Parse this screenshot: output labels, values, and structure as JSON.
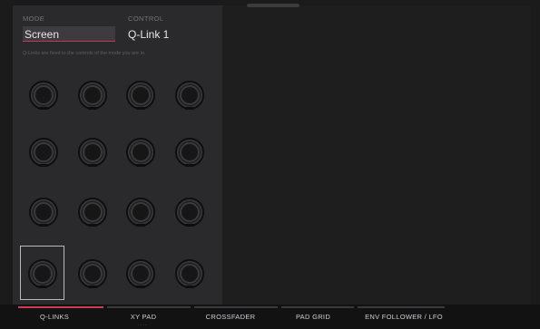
{
  "header": {
    "mode_label": "MODE",
    "mode_value": "Screen",
    "control_label": "CONTROL",
    "control_value": "Q-Link 1",
    "hint": "Q-Links are fixed to the controls of the mode you are in"
  },
  "knobs": {
    "count": 16,
    "selected_index": 12
  },
  "tabs": [
    {
      "label": "Q-LINKS",
      "active": true
    },
    {
      "label": "XY PAD",
      "active": false
    },
    {
      "label": "CROSSFADER",
      "active": false
    },
    {
      "label": "PAD GRID",
      "active": false
    },
    {
      "label": "ENV FOLLOWER / LFO",
      "active": false
    }
  ],
  "tab_page_dots": "····",
  "colors": {
    "accent": "#d13a55",
    "panel": "#2a2a2c",
    "background": "#1b1b1b"
  }
}
